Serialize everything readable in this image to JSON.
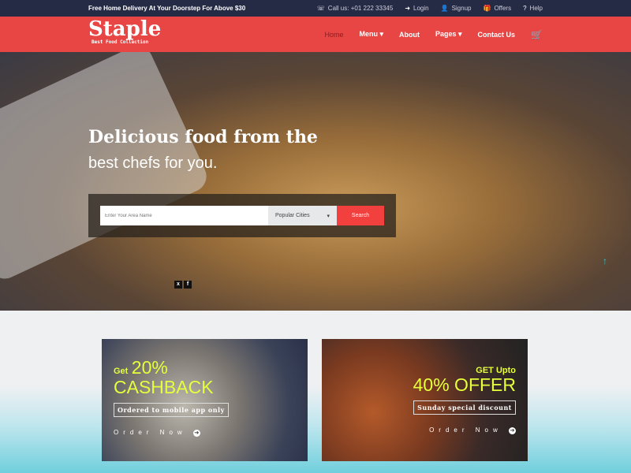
{
  "topbar": {
    "promo": "Free Home Delivery At Your Doorstep For Above $30",
    "call": "Call us: +01 222 33345",
    "login": "Login",
    "signup": "Signup",
    "offers": "Offers",
    "help": "Help"
  },
  "brand": {
    "name": "Staple",
    "tagline": "Best Food Collection",
    "accent": "#e84545"
  },
  "nav": {
    "items": [
      "Home",
      "Menu ▾",
      "About",
      "Pages ▾",
      "Contact Us"
    ],
    "active": "Home"
  },
  "hero": {
    "title": "Delicious food from the",
    "subtitle": "best chefs for you.",
    "search": {
      "placeholder": "Enter Your Area Name",
      "city": "Popular Cities",
      "button": "Search"
    },
    "social": [
      "x",
      "f"
    ]
  },
  "offers": [
    {
      "small": "Get",
      "big_top": "20%",
      "big": "CASHBACK",
      "tag": "Ordered to mobile app only",
      "cta": "Order Now"
    },
    {
      "small": "GET Upto",
      "big": "40% OFFER",
      "tag": "Sunday special discount",
      "cta": "Order Now"
    }
  ]
}
